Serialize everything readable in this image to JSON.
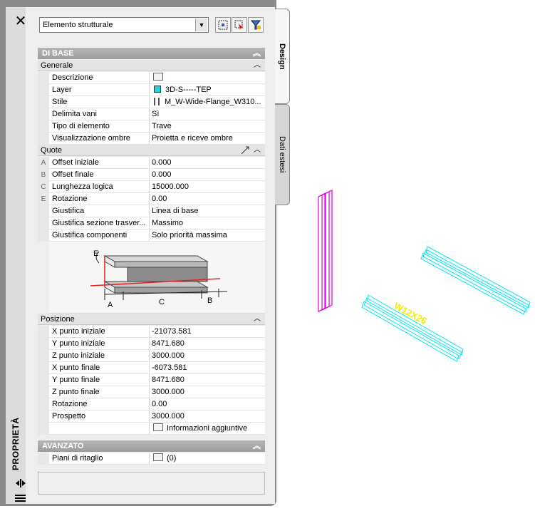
{
  "palette": {
    "strip_title": "PROPRIETÀ",
    "tabs": {
      "design": "Design",
      "dati": "Dati estesi"
    },
    "selection": "Elemento strutturale"
  },
  "sections": {
    "base": "DI BASE",
    "generale": "Generale",
    "quote": "Quote",
    "posizione": "Posizione",
    "avanzato": "AVANZATO"
  },
  "generale": [
    {
      "label": "Descrizione",
      "value": ""
    },
    {
      "label": "Layer",
      "value": "3D-S-----TEP"
    },
    {
      "label": "Stile",
      "value": "M_W-Wide-Flange_W310..."
    },
    {
      "label": "Delimita vani",
      "value": "Sì"
    },
    {
      "label": "Tipo di elemento",
      "value": "Trave"
    },
    {
      "label": "Visualizzazione ombre",
      "value": "Proietta e riceve ombre"
    }
  ],
  "quote": [
    {
      "gutter": "A",
      "label": "Offset iniziale",
      "value": "0.000"
    },
    {
      "gutter": "B",
      "label": "Offset finale",
      "value": "0.000"
    },
    {
      "gutter": "C",
      "label": "Lunghezza logica",
      "value": "15000.000"
    },
    {
      "gutter": "E",
      "label": "Rotazione",
      "value": "0.00"
    },
    {
      "gutter": "",
      "label": "Giustifica",
      "value": "Linea di base"
    },
    {
      "gutter": "",
      "label": "Giustifica sezione trasver...",
      "value": "Massimo"
    },
    {
      "gutter": "",
      "label": "Giustifica componenti",
      "value": "Solo priorità massima"
    }
  ],
  "diagram_labels": {
    "e": "E",
    "a": "A",
    "c": "C",
    "b": "B"
  },
  "posizione": [
    {
      "label": "X punto iniziale",
      "value": "-21073.581"
    },
    {
      "label": "Y punto iniziale",
      "value": "8471.680"
    },
    {
      "label": "Z punto iniziale",
      "value": "3000.000"
    },
    {
      "label": "X punto finale",
      "value": "-6073.581"
    },
    {
      "label": "Y punto finale",
      "value": "8471.680"
    },
    {
      "label": "Z punto finale",
      "value": "3000.000"
    },
    {
      "label": "Rotazione",
      "value": "0.00"
    },
    {
      "label": "Prospetto",
      "value": "3000.000"
    },
    {
      "label": "",
      "value": "Informazioni aggiuntive"
    }
  ],
  "avanzato": [
    {
      "label": "Piani di ritaglio",
      "value": "(0)"
    }
  ],
  "canvas": {
    "beam_label": "W12X26",
    "colors": {
      "magenta": "#e000e0",
      "cyan": "#00e8f0",
      "yellow": "#f0f000"
    }
  }
}
